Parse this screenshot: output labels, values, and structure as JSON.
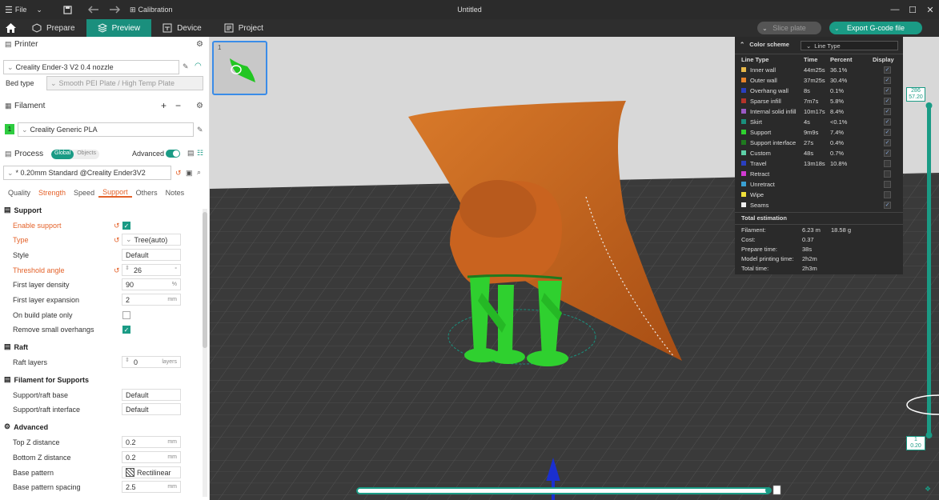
{
  "titlebar": {
    "file_label": "File",
    "calibration_label": "Calibration",
    "window_title": "Untitled"
  },
  "tabs": {
    "prepare": "Prepare",
    "preview": "Preview",
    "device": "Device",
    "project": "Project"
  },
  "actions": {
    "slice_plate": "Slice plate",
    "export_gcode": "Export G-code file"
  },
  "printer": {
    "section_label": "Printer",
    "selected": "Creality Ender-3 V2 0.4 nozzle",
    "bed_type_label": "Bed type",
    "bed_type_value": "Smooth PEI Plate / High Temp Plate"
  },
  "filament": {
    "section_label": "Filament",
    "slot_number": "1",
    "slot_color": "#2ecc40",
    "selected": "Creality Generic PLA"
  },
  "process": {
    "section_label": "Process",
    "global_label": "Global",
    "objects_label": "Objects",
    "advanced_label": "Advanced",
    "preset": "* 0.20mm Standard @Creality Ender3V2",
    "subtabs": [
      "Quality",
      "Strength",
      "Speed",
      "Support",
      "Others",
      "Notes"
    ]
  },
  "support_settings": {
    "group_support": "Support",
    "enable_support_label": "Enable support",
    "type_label": "Type",
    "type_value": "Tree(auto)",
    "style_label": "Style",
    "style_value": "Default",
    "threshold_angle_label": "Threshold angle",
    "threshold_angle_value": "26",
    "threshold_angle_unit": "°",
    "first_layer_density_label": "First layer density",
    "first_layer_density_value": "90",
    "first_layer_density_unit": "%",
    "first_layer_expansion_label": "First layer expansion",
    "first_layer_expansion_value": "2",
    "first_layer_expansion_unit": "mm",
    "on_build_plate_only_label": "On build plate only",
    "remove_small_overhangs_label": "Remove small overhangs",
    "group_raft": "Raft",
    "raft_layers_label": "Raft layers",
    "raft_layers_value": "0",
    "raft_layers_unit": "layers",
    "group_filament_supports": "Filament for Supports",
    "support_raft_base_label": "Support/raft base",
    "support_raft_base_value": "Default",
    "support_raft_interface_label": "Support/raft interface",
    "support_raft_interface_value": "Default",
    "group_advanced": "Advanced",
    "top_z_label": "Top Z distance",
    "top_z_value": "0.2",
    "bottom_z_label": "Bottom Z distance",
    "bottom_z_value": "0.2",
    "z_unit": "mm",
    "base_pattern_label": "Base pattern",
    "base_pattern_value": "Rectilinear",
    "base_pattern_spacing_label": "Base pattern spacing",
    "base_pattern_spacing_value": "2.5",
    "base_pattern_spacing_unit": "mm"
  },
  "plate": {
    "number": "1"
  },
  "legend": {
    "title": "Color scheme",
    "scheme": "Line Type",
    "col_line_type": "Line Type",
    "col_time": "Time",
    "col_percent": "Percent",
    "col_display": "Display",
    "rows": [
      {
        "name": "Inner wall",
        "time": "44m25s",
        "percent": "36.1%",
        "color": "#e8b94a",
        "display": true
      },
      {
        "name": "Outer wall",
        "time": "37m25s",
        "percent": "30.4%",
        "color": "#e8832a",
        "display": true
      },
      {
        "name": "Overhang wall",
        "time": "8s",
        "percent": "0.1%",
        "color": "#2a3fbf",
        "display": true
      },
      {
        "name": "Sparse infill",
        "time": "7m7s",
        "percent": "5.8%",
        "color": "#b5342a",
        "display": true
      },
      {
        "name": "Internal solid infill",
        "time": "10m17s",
        "percent": "8.4%",
        "color": "#9a5ac6",
        "display": true
      },
      {
        "name": "Skirt",
        "time": "4s",
        "percent": "<0.1%",
        "color": "#1a8f7d",
        "display": true
      },
      {
        "name": "Support",
        "time": "9m9s",
        "percent": "7.4%",
        "color": "#2fd02f",
        "display": true
      },
      {
        "name": "Support interface",
        "time": "27s",
        "percent": "0.4%",
        "color": "#1f7a1f",
        "display": true
      },
      {
        "name": "Custom",
        "time": "48s",
        "percent": "0.7%",
        "color": "#5ed1a8",
        "display": true
      },
      {
        "name": "Travel",
        "time": "13m18s",
        "percent": "10.8%",
        "color": "#2a3fbf",
        "display": false
      },
      {
        "name": "Retract",
        "time": "",
        "percent": "",
        "color": "#d23ad2",
        "display": false
      },
      {
        "name": "Unretract",
        "time": "",
        "percent": "",
        "color": "#3aa0d2",
        "display": false
      },
      {
        "name": "Wipe",
        "time": "",
        "percent": "",
        "color": "#f0e03a",
        "display": false
      },
      {
        "name": "Seams",
        "time": "",
        "percent": "",
        "color": "#f0f0f0",
        "display": true
      }
    ],
    "total_label": "Total estimation",
    "totals": [
      {
        "key": "Filament:",
        "value": "6.23 m",
        "value2": "18.58 g"
      },
      {
        "key": "Cost:",
        "value": "0.37",
        "value2": ""
      },
      {
        "key": "Prepare time:",
        "value": "38s",
        "value2": ""
      },
      {
        "key": "Model printing time:",
        "value": "2h2m",
        "value2": ""
      },
      {
        "key": "Total time:",
        "value": "2h3m",
        "value2": ""
      }
    ]
  },
  "layer_slider": {
    "top_layer": "286",
    "top_height": "57.20",
    "bottom_layer": "1",
    "bottom_height": "0.20"
  },
  "colors": {
    "accent": "#1a9b85",
    "model": "#c9631f",
    "support": "#2fd02f"
  }
}
